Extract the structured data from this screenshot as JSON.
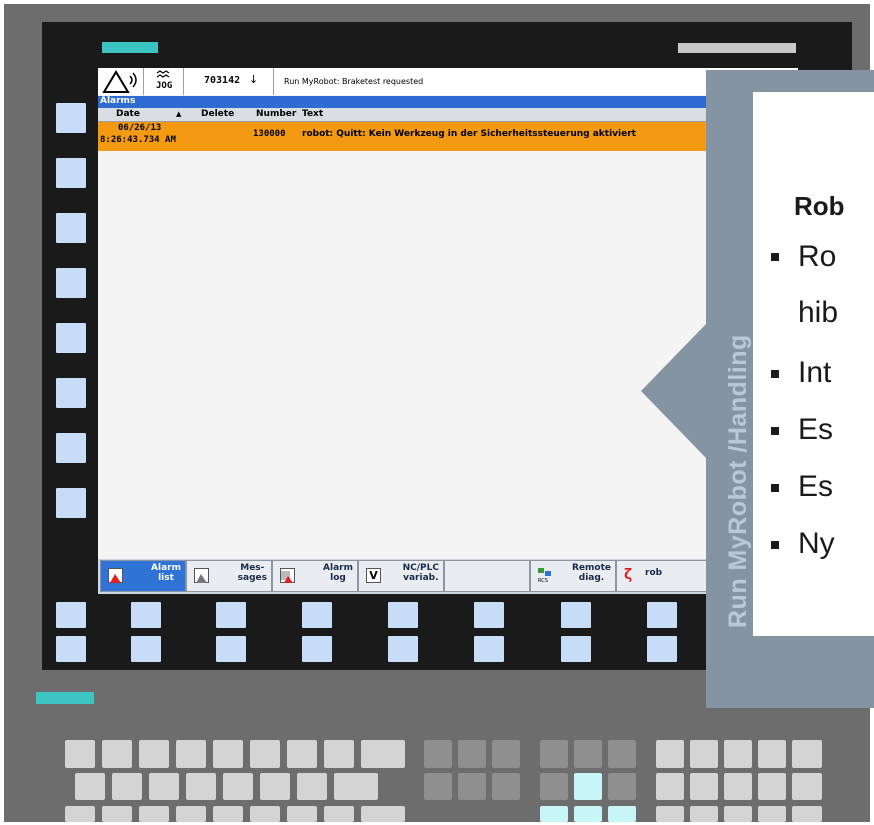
{
  "status_bar": {
    "mode_label": "JOG",
    "program_number": "703142",
    "message": "Run MyRobot: Braketest requested"
  },
  "alarms": {
    "title": "Alarms",
    "columns": [
      "Date",
      "Delete",
      "Number",
      "Text"
    ],
    "rows": [
      {
        "date": "06/26/13",
        "time": "8:26:43.734 AM",
        "delete": "",
        "number": "130000",
        "text": "robot: Quitt: Kein Werkzeug in der Sicherheitssteuerung aktiviert"
      }
    ]
  },
  "softkeys": [
    {
      "line1": "Alarm",
      "line2": "list",
      "icon": "alarm-list-icon",
      "active": true
    },
    {
      "line1": "Mes-",
      "line2": "sages",
      "icon": "messages-icon",
      "active": false
    },
    {
      "line1": "Alarm",
      "line2": "log",
      "icon": "alarm-log-icon",
      "active": false
    },
    {
      "line1": "NC/PLC",
      "line2": "variab.",
      "icon": "variable-icon",
      "active": false
    },
    {
      "line1": "",
      "line2": "",
      "icon": "",
      "active": false
    },
    {
      "line1": "Remote",
      "line2": "diag.",
      "icon": "rcs-icon",
      "active": false
    },
    {
      "line1": "rob",
      "line2": "",
      "icon": "robot-icon",
      "active": false
    }
  ],
  "overlay_panel": {
    "vertical_title": "Run MyRobot /Handling",
    "heading": "Rob",
    "bullets": [
      "Ro",
      "hib",
      "Int",
      "Es",
      "Es",
      "Ny"
    ]
  },
  "colors": {
    "accent_teal": "#3bc4c1",
    "alarm_row": "#f39a12",
    "alarm_header": "#2e6bd3",
    "softkey_blue": "#c7dcf7",
    "overlay_panel": "#8494a2"
  }
}
